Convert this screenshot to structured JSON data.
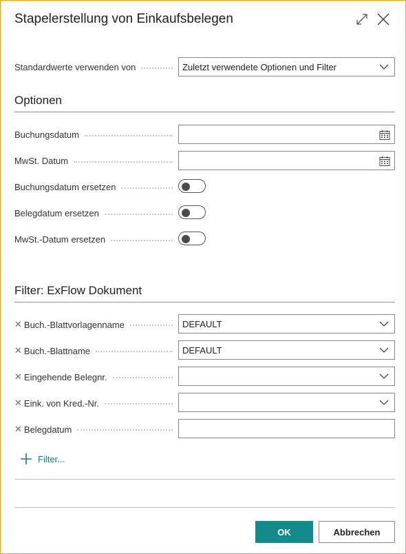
{
  "dialog": {
    "title": "Stapelerstellung von Einkaufsbelegen",
    "expand_icon": "expand-icon",
    "close_icon": "close-icon"
  },
  "defaults": {
    "label": "Standardwerte verwenden von",
    "value": "Zuletzt verwendete Optionen und Filter"
  },
  "options": {
    "heading": "Optionen",
    "buchungsdatum_label": "Buchungsdatum",
    "buchungsdatum_value": "",
    "mwst_datum_label": "MwSt. Datum",
    "mwst_datum_value": "",
    "toggle1_label": "Buchungsdatum ersetzen",
    "toggle1_on": false,
    "toggle2_label": "Belegdatum ersetzen",
    "toggle2_on": false,
    "toggle3_label": "MwSt.-Datum ersetzen",
    "toggle3_on": false
  },
  "filter": {
    "heading": "Filter: ExFlow Dokument",
    "rows": [
      {
        "label": "Buch.-Blattvorlagenname",
        "value": "DEFAULT"
      },
      {
        "label": "Buch.-Blattname",
        "value": "DEFAULT"
      },
      {
        "label": "Eingehende Belegnr.",
        "value": ""
      },
      {
        "label": "Eink. von Kred.-Nr.",
        "value": ""
      },
      {
        "label": "Belegdatum",
        "value": ""
      }
    ],
    "add_filter_label": "Filter..."
  },
  "buttons": {
    "ok": "OK",
    "cancel": "Abbrechen"
  },
  "colors": {
    "accent": "#138a8c",
    "window_border": "#e8a317"
  }
}
